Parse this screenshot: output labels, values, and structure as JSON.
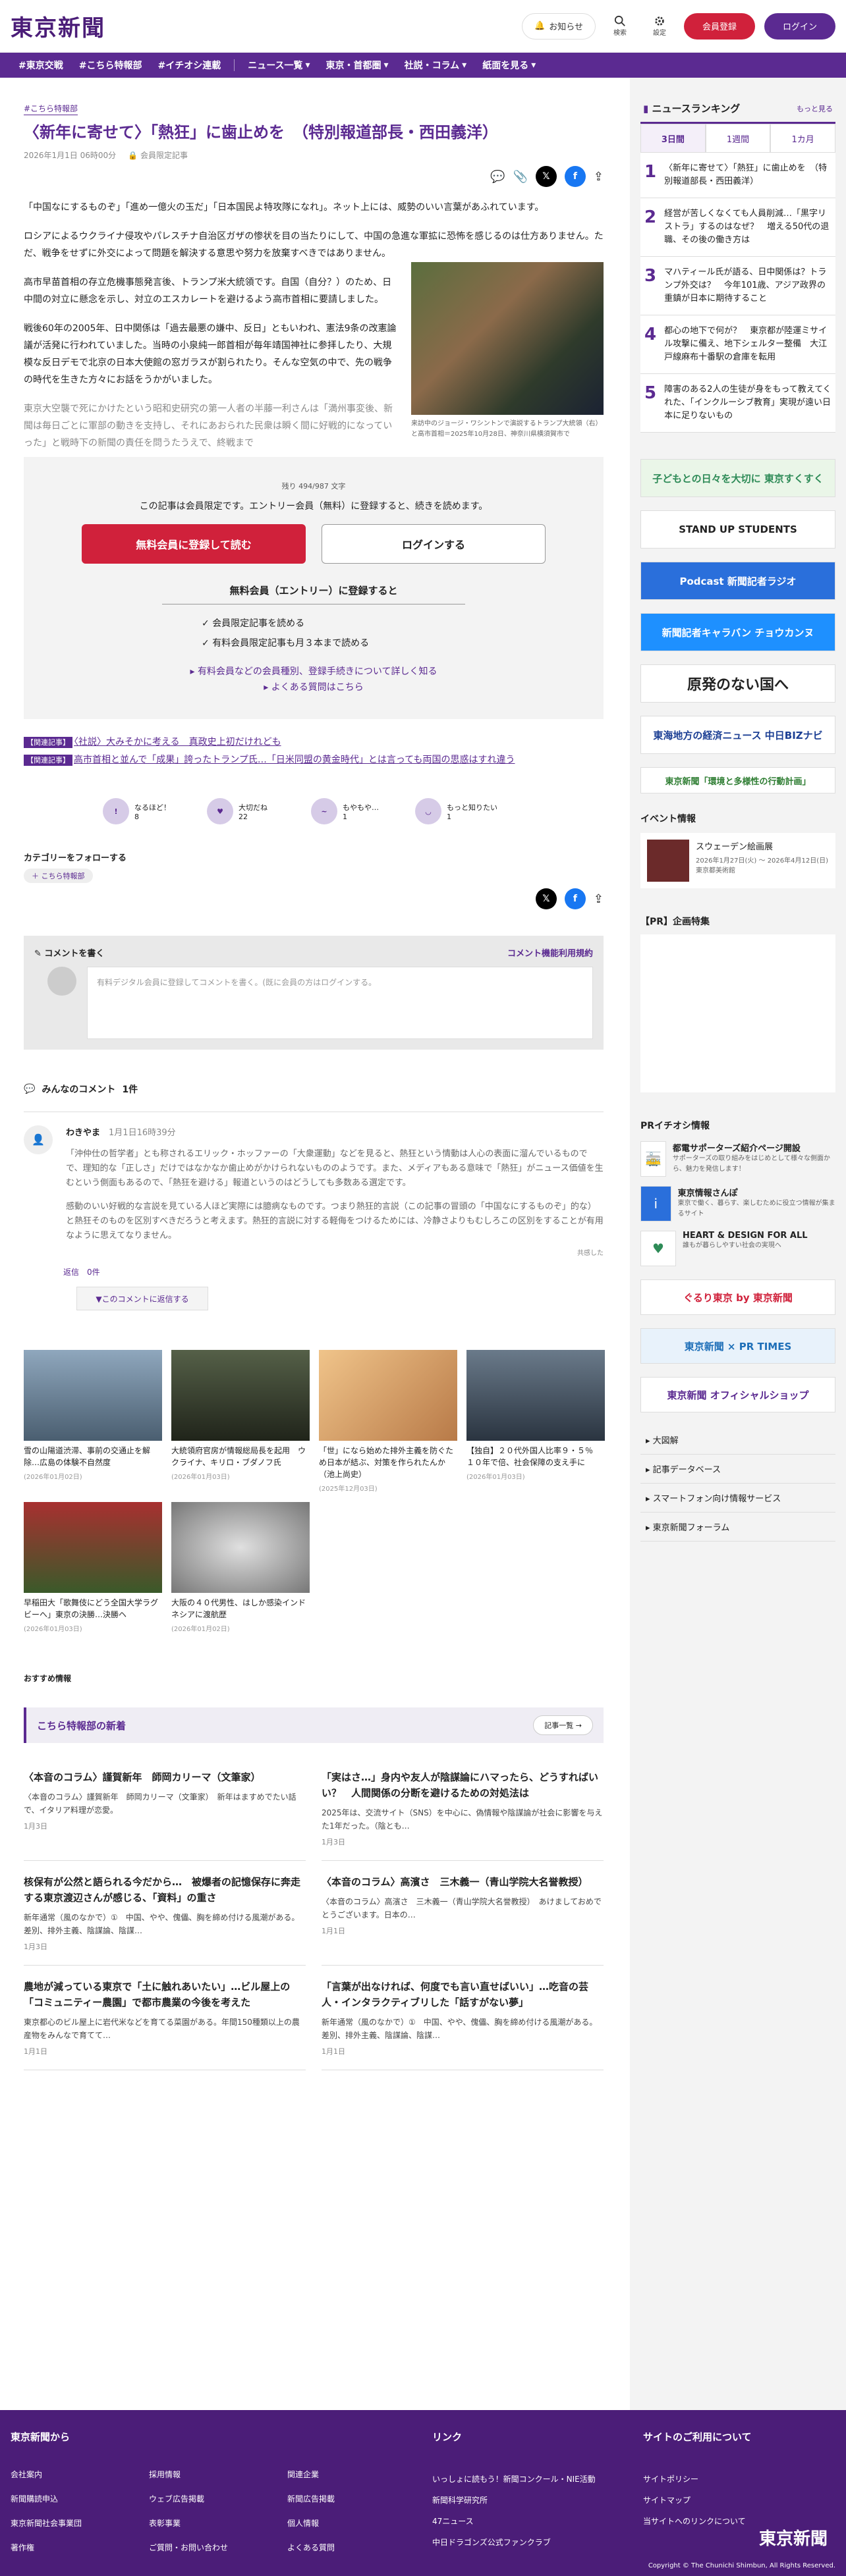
{
  "header": {
    "logo": "東京新聞",
    "notice": "お知らせ",
    "search": "検索",
    "settings": "設定",
    "register": "会員登録",
    "login": "ログイン"
  },
  "nav": [
    "#東京交戦",
    "#こちら特報部",
    "#イチオシ連載",
    "ニュース一覧",
    "東京・首都圏",
    "社説・コラム",
    "紙面を見る"
  ],
  "article": {
    "category": "#こちら特報部",
    "title": "〈新年に寄せて〉「熱狂」に歯止めを　（特別報道部長・西田義洋）",
    "date": "2026年1月1日 06時00分",
    "members": "会員限定記事",
    "paras": [
      "「中国なにするものぞ」「進め一億火の玉だ」「日本国民よ特攻隊になれ」。ネット上には、威勢のいい言葉があふれています。",
      "ロシアによるウクライナ侵攻やパレスチナ自治区ガザの惨状を目の当たりにして、中国の急進な軍拡に恐怖を感じるのは仕方ありません。ただ、戦争をせずに外交によって問題を解決する意思や努力を放棄すべきではありません。",
      "高市早苗首相の存立危機事態発言後、トランプ米大統領です。自国（自分？）のため、日中間の対立に懸念を示し、対立のエスカレートを避けるよう高市首相に要請しました。",
      "戦後60年の2005年、日中関係は「過去最悪の嫌中、反日」ともいわれ、憲法9条の改憲論議が活発に行われていました。当時の小泉純一郎首相が毎年靖国神社に参拝したり、大規模な反日デモで北京の日本大使館の窓ガラスが割られたり。そんな空気の中で、先の戦争の時代を生きた方々にお話をうかがいました。",
      "東京大空襲で死にかけたという昭和史研究の第一人者の半藤一利さんは「満州事変後、新聞は毎日ごとに軍部の動きを支持し、それにあおられた民衆は瞬く間に好戦的になっていった」と戦時下の新聞の責任を問うたうえで、終戦まで"
    ],
    "caption": "来訪中のジョージ・ワシントンで演説するトランプ大統領（右）と高市首相＝2025年10月28日、神奈川県横須賀市で"
  },
  "paywall": {
    "remaining": "残り 494/987 文字",
    "message": "この記事は会員限定です。エントリー会員（無料）に登録すると、続きを読めます。",
    "register_btn": "無料会員に登録して読む",
    "login_btn": "ログインする",
    "free_head": "無料会員（エントリー）に登録すると",
    "checks": [
      "会員限定記事を読める",
      "有料会員限定記事も月３本まで読める"
    ],
    "links": [
      "有料会員などの会員種別、登録手続きについて詳しく知る",
      "よくある質問はこちら"
    ]
  },
  "related": [
    {
      "tag": "【関連記事】",
      "text": "〈社説〉大みそかに考える　真政史上初だけれども"
    },
    {
      "tag": "【関連記事】",
      "text": "高市首相と並んで「成果」誇ったトランプ氏…「日米同盟の黄金時代」とは言っても両国の思惑はすれ違う"
    }
  ],
  "reactions": [
    {
      "label": "なるほど！",
      "count": "8"
    },
    {
      "label": "大切だね",
      "count": "22"
    },
    {
      "label": "もやもや…",
      "count": "1"
    },
    {
      "label": "もっと知りたい",
      "count": "1"
    }
  ],
  "follow": {
    "label": "カテゴリーをフォローする",
    "chip": "＋ こちら特報部"
  },
  "comment_form": {
    "title": "コメントを書く",
    "rules": "コメント機能利用規約",
    "prompt": "有料デジタル会員に登録してコメントを書く。(既に会員の方はログインする。"
  },
  "comments": {
    "title": "みんなのコメント",
    "count": "1件",
    "user": "わきやま",
    "time": "1月1日16時39分",
    "text1": "「沖仲仕の哲学者」とも称されるエリック・ホッファーの「大衆運動」などを見ると、熱狂という情動は人心の表面に溜んでいるものでで、理知的な「正しさ」だけではなかなか歯止めがかけられないもののようです。また、メディアもある意味で「熱狂」がニュース価値を生むという側面もあるので、「熱狂を避ける」報道というのはどうしても多数ある選定です。",
    "text2": "感動のいい好戦的な言説を見ている人ほど実際には臆病なものです。つまり熱狂的言説（この記事の冒頭の「中国なにするものぞ」的な）と熱狂そのものを区別すべきだろうと考えます。熱狂的言説に対する軽侮をつけるためには、冷静さよりもむしろこの区別をすることが有用なように思えてなりません。",
    "reply_count": "返信　0件",
    "reply_btn": "▼このコメントに返信する",
    "helpful": "共感した"
  },
  "cards": [
    {
      "t": "雪の山陽道渋滞、事前の交通止を解除…広島の体験不自然度",
      "d": "(2026年01月02日)",
      "c": "#6b8aa3"
    },
    {
      "t": "大統領府官房が情報総局長を起用　ウクライナ、キリロ・ブダノフ氏",
      "d": "(2026年01月03日)",
      "c": "#3a4030"
    },
    {
      "t": "「世」になら始めた排外主義を防ぐため日本が結ぶ、対策を作られたんか（池上尚史）",
      "d": "(2025年12月03日)",
      "c": "#d7a87a"
    },
    {
      "t": "【独自】２０代外国人比率９・５％　１０年で倍、社会保障の支え手に",
      "d": "(2026年01月03日)",
      "c": "#4a5a6a"
    },
    {
      "t": "早稲田大「歌舞伎にどう全国大学ラグビーへ」東京の決勝…決勝ヘ",
      "d": "(2026年01月03日)",
      "c": "#7a2020"
    },
    {
      "t": "大阪の４０代男性、はしか感染インドネシアに渡航歴",
      "d": "(2026年01月02日)",
      "c": "#aaaaaa"
    }
  ],
  "osusume": "おすすめ情報",
  "tokuhou": {
    "title": "こちら特報部の新着",
    "more": "記事一覧 →",
    "items": [
      {
        "t": "〈本音のコラム〉謹賀新年　師岡カリーマ（文筆家）",
        "e": "〈本音のコラム〉謹賀新年　師岡カリーマ（文筆家）　新年はますめでたい話で、イタリア料理が恋愛。",
        "d": "1月3日"
      },
      {
        "t": "「実はさ…」身内や友人が陰謀論にハマったら、どうすればいい？　人間関係の分断を避けるための対処法は",
        "e": "2025年は、交流サイト（SNS）を中心に、偽情報や陰謀論が社会に影響を与えた1年だった。（陰とも…",
        "d": "1月3日"
      },
      {
        "t": "核保有が公然と語られる今だから…　被爆者の記憶保存に奔走する東京渡辺さんが感じる、「資料」の重さ",
        "e": "新年通常（風のなかで）①　中国、やや、傀儡、胸を締め付ける風潮がある。差別、排外主義、陰謀論、陰謀…",
        "d": "1月3日"
      },
      {
        "t": "〈本音のコラム〉高濱さ　三木義一（青山学院大名誉教授）",
        "e": "〈本音のコラム〉高濱さ　三木義一（青山学院大名誉教授）　あけましておめでとうございます。日本の…",
        "d": "1月1日"
      },
      {
        "t": "農地が減っている東京で「土に触れあいたい」…ビル屋上の「コミュニティー農園」で都市農業の今後を考えた",
        "e": "東京都心のビル屋上に岩代米などを育てる菜園がある。年間150種類以上の農産物をみんなで育てて…",
        "d": "1月1日"
      },
      {
        "t": "「言葉が出なければ、何度でも言い直せばいい」…吃音の芸人・インタラクティブリした「話すがない夢」",
        "e": "新年通常（風のなかで）①　中国、やや、傀儡、胸を締め付ける風潮がある。差別、排外主義、陰謀論、陰謀…",
        "d": "1月1日"
      }
    ]
  },
  "sidebar": {
    "ranking_title": "ニュースランキング",
    "ranking_more": "もっと見る",
    "tabs": [
      "3日間",
      "1週間",
      "1カ月"
    ],
    "ranking": [
      {
        "n": "1",
        "t": "〈新年に寄せて〉「熱狂」に歯止めを　（特別報道部長・西田義洋）"
      },
      {
        "n": "2",
        "t": "経営が苦しくなくても人員削減…「黒字リストラ」するのはなぜ？　増える50代の退職、その後の働き方は"
      },
      {
        "n": "3",
        "t": "マハティール氏が語る、日中関係は？トランプ外交は？　今年101歳、アジア政界の重鎮が日本に期待すること"
      },
      {
        "n": "4",
        "t": "都心の地下で何が？　東京都が陸運ミサイル攻撃に備え、地下シェルター整備　大江戸線麻布十番駅の倉庫を転用"
      },
      {
        "n": "5",
        "t": "障害のある2人の生徒が身をもって教えてくれた、「インクルーシブ教育」実現が遠い日本に足りないもの"
      }
    ],
    "banners": [
      {
        "t": "子どもとの日々を大切に 東京すくすく",
        "bg": "#eaf6e8",
        "c": "#2e8b57"
      },
      {
        "t": "STAND UP STUDENTS",
        "bg": "#ffffff",
        "c": "#222222"
      },
      {
        "t": "Podcast 新聞記者ラジオ",
        "bg": "#2a6fdb",
        "c": "#ffffff"
      },
      {
        "t": "新聞記者キャラバン チョウカンヌ",
        "bg": "#1e90ff",
        "c": "#ffffff"
      },
      {
        "t": "原発のない国へ",
        "bg": "#ffffff",
        "c": "#222222"
      },
      {
        "t": "東海地方の経済ニュース 中日BIZナビ",
        "bg": "#ffffff",
        "c": "#1c3f94"
      },
      {
        "t": "東京新聞「環境と多様性の行動計画」",
        "bg": "#ffffff",
        "c": "#2e7d32"
      }
    ],
    "event_title": "イベント情報",
    "event": {
      "t": "スウェーデン絵画展",
      "d": "2026年1月27日(火) ～ 2026年4月12日(日)  東京都美術館"
    },
    "pr_title": "【PR】企画特集",
    "pr2_title": "PRイチオシ情報",
    "pr_items": [
      {
        "t": "都電サポーターズ紹介ページ開設",
        "d": "サポーターズの取り組みをはじめとして様々な側面から、魅力を発信します！",
        "i": "🚋"
      },
      {
        "t": "東京情報さんぽ",
        "d": "東京で働く、暮らす、楽しむために役立つ情報が集まるサイト",
        "i": "i"
      },
      {
        "t": "HEART & DESIGN FOR ALL",
        "d": "誰もが暮らしやすい社会の実現へ",
        "i": "♥"
      }
    ],
    "banners2": [
      {
        "t": "ぐるり東京 by 東京新聞",
        "bg": "#ffffff",
        "c": "#d0213b"
      },
      {
        "t": "東京新聞 × PR TIMES",
        "bg": "#e8f2fb",
        "c": "#1e6fb8"
      },
      {
        "t": "東京新聞 オフィシャルショップ",
        "bg": "#ffffff",
        "c": "#5b2a91"
      }
    ],
    "links": [
      "大図解",
      "記事データベース",
      "スマートフォン向け情報サービス",
      "東京新聞フォーラム"
    ]
  },
  "footer": {
    "col1": "東京新聞から",
    "col2": "リンク",
    "col3": "サイトのご利用について",
    "links1": [
      "会社案内",
      "採用情報",
      "関連企業",
      "新聞購読申込",
      "ウェブ広告掲載",
      "新聞広告掲載",
      "東京新聞社会事業団",
      "表彰事業",
      "個人情報",
      "著作権",
      "ご質問・お問い合わせ",
      "よくある質問"
    ],
    "links2": [
      "いっしょに読もう！新聞コンクール・NIE活動",
      "新聞科学研究所",
      "47ニュース",
      "中日ドラゴンズ公式ファンクラブ"
    ],
    "links3": [
      "サイトポリシー",
      "サイトマップ",
      "当サイトへのリンクについて"
    ],
    "logo": "東京新聞",
    "copy": "Copyright © The Chunichi Shimbun, All Rights Reserved."
  }
}
